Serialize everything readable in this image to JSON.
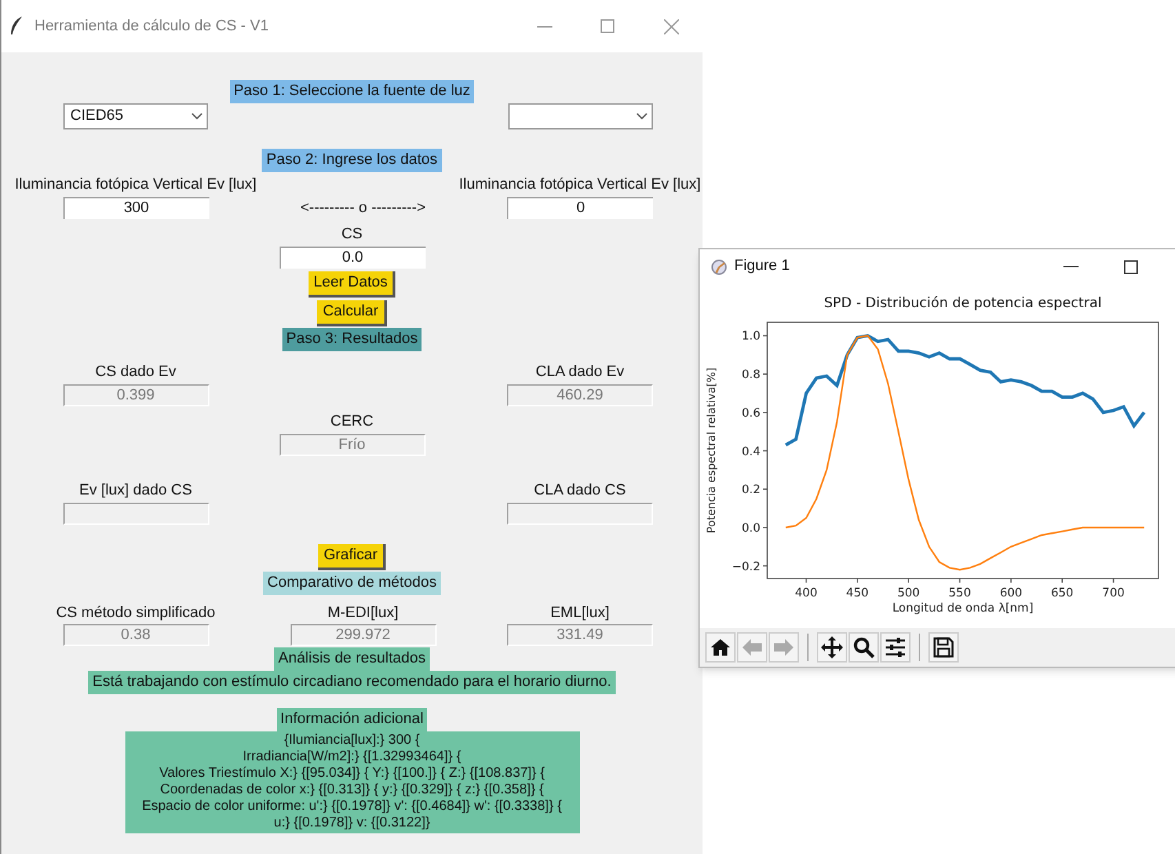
{
  "window": {
    "title": "Herramienta de cálculo de CS - V1"
  },
  "step1": {
    "label": "Paso 1: Seleccione la fuente de luz",
    "dropdowns": [
      {
        "kind": "filled",
        "value": "CIED65"
      },
      {
        "kind": "empty"
      }
    ]
  },
  "step2": {
    "label": "Paso 2: Ingrese los datos",
    "left_label": "Iluminancia fotópica Vertical Ev [lux]",
    "left_value": "300",
    "separator": "<--------- o --------->",
    "right_label": "Iluminancia fotópica Vertical Ev [lux]",
    "right_value": "0",
    "cs_label": "CS",
    "cs_value": "0.0",
    "buttons": [
      "Leer Datos",
      "Calcular"
    ]
  },
  "step3": {
    "label": "Paso 3: Resultados",
    "cs_dado_ev": {
      "label": "CS dado Ev",
      "value": "0.399"
    },
    "cla_dado_ev": {
      "label": "CLA dado Ev",
      "value": "460.29"
    },
    "cerc": {
      "label": "CERC",
      "value": "Frío"
    },
    "ev_dado_cs": {
      "label": "Ev [lux] dado CS"
    },
    "cla_dado_cs": {
      "label": "CLA dado CS"
    }
  },
  "graph_button": "Graficar",
  "comparison": {
    "label": "Comparativo de métodos",
    "items": [
      {
        "label": "CS método simplificado",
        "value": "0.38"
      },
      {
        "label": "M-EDI[lux]",
        "value": "299.972"
      },
      {
        "label": "EML[lux]",
        "value": "331.49"
      }
    ]
  },
  "analysis": {
    "label": "Análisis de resultados",
    "message": "Está trabajando con estímulo circadiano recomendado para el horario diurno."
  },
  "info": {
    "label": "Información adicional",
    "lines": [
      "{Ilumiancia[lux]:} 300 {",
      "Irradiancia[W/m2]:} {[1.32993464]} {",
      "Valores Triestímulo X:} {[95.034]} { Y:} {[100.]} { Z:} {[108.837]} {",
      "Coordenadas de color x:} {[0.313]} { y:} {[0.329]} { z:} {[0.358]} {",
      "Espacio de color uniforme: u':} {[0.1978]} v': {[0.4684]} w': {[0.3338]} {",
      "u:} {[0.1978]} v: {[0.3122]}"
    ]
  },
  "figure": {
    "title": "Figure 1",
    "chart_data": {
      "type": "line",
      "title": "SPD - Distribución de potencia espectral",
      "xlabel": "Longitud de onda λ[nm]",
      "ylabel": "Potencia espectral relativa[%]",
      "x": [
        380,
        390,
        400,
        410,
        420,
        430,
        440,
        450,
        460,
        470,
        480,
        490,
        500,
        510,
        520,
        530,
        540,
        550,
        560,
        570,
        580,
        590,
        600,
        610,
        620,
        630,
        640,
        650,
        660,
        670,
        680,
        690,
        700,
        710,
        720,
        730
      ],
      "series": [
        {
          "color": "#1f77b4",
          "values": [
            0.43,
            0.46,
            0.7,
            0.78,
            0.79,
            0.74,
            0.9,
            0.99,
            1.0,
            0.97,
            0.98,
            0.92,
            0.92,
            0.91,
            0.89,
            0.91,
            0.88,
            0.88,
            0.85,
            0.82,
            0.81,
            0.76,
            0.77,
            0.76,
            0.74,
            0.71,
            0.71,
            0.68,
            0.68,
            0.7,
            0.67,
            0.6,
            0.61,
            0.63,
            0.53,
            0.6
          ]
        },
        {
          "color": "#ff7f0e",
          "values": [
            0,
            0.01,
            0.05,
            0.15,
            0.3,
            0.55,
            0.9,
            0.99,
            1.0,
            0.93,
            0.75,
            0.5,
            0.25,
            0.04,
            -0.1,
            -0.18,
            -0.21,
            -0.22,
            -0.21,
            -0.19,
            -0.16,
            -0.13,
            -0.1,
            -0.08,
            -0.06,
            -0.04,
            -0.03,
            -0.02,
            -0.01,
            0,
            0,
            0,
            0,
            0,
            0,
            0
          ]
        }
      ],
      "xlim": [
        362,
        744
      ],
      "ylim": [
        -0.266,
        1.07
      ],
      "xticks": [
        400,
        450,
        500,
        550,
        600,
        650,
        700
      ],
      "yticks": [
        {
          "value": -0.2,
          "label": "−0.2"
        },
        {
          "value": 0,
          "label": "0.0"
        },
        {
          "value": 0.2,
          "label": "0.2"
        },
        {
          "value": 0.4,
          "label": "0.4"
        },
        {
          "value": 0.6,
          "label": "0.6"
        },
        {
          "value": 0.8,
          "label": "0.8"
        },
        {
          "value": 1,
          "label": "1.0"
        }
      ]
    },
    "toolbar": [
      {
        "kind": "home",
        "disabled": false
      },
      {
        "kind": "back",
        "disabled": true
      },
      {
        "kind": "forward",
        "disabled": true
      },
      {
        "kind": "pan",
        "disabled": false
      },
      {
        "kind": "zoom",
        "disabled": false
      },
      {
        "kind": "configure",
        "disabled": false
      },
      {
        "kind": "save",
        "disabled": false
      }
    ]
  }
}
